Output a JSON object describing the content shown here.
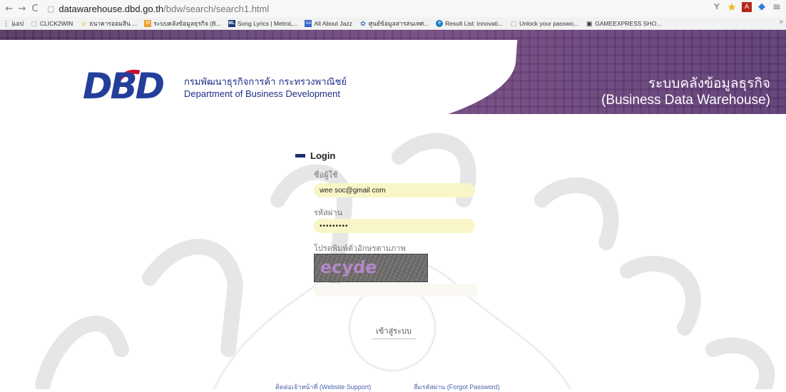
{
  "browser": {
    "url_host": "datawarehouse.dbd.go.th",
    "url_path": "/bdw/search/search1.html",
    "bookmarks": [
      {
        "label": "แอป",
        "icon": "apps-icon"
      },
      {
        "label": "CLICK2WIN",
        "icon": "page-icon"
      },
      {
        "label": "ธนาคารออมสิน ...",
        "icon": "smiley-icon"
      },
      {
        "label": "ระบบคลังข้อมูลธุรกิจ (B...",
        "icon": "mail-icon"
      },
      {
        "label": "Song Lyrics | MetroL...",
        "icon": "metrolyrics-icon"
      },
      {
        "label": "All About Jazz",
        "icon": "jazz-icon"
      },
      {
        "label": "ศูนย์ข้อมูลสารสนเทศ...",
        "icon": "flower-icon"
      },
      {
        "label": "Result List: innovati...",
        "icon": "globe-icon"
      },
      {
        "label": "Unlock your passwo...",
        "icon": "page-icon"
      },
      {
        "label": "GAMEEXPRESS SHO...",
        "icon": "gamepad-icon"
      }
    ],
    "more_label": "»"
  },
  "banner": {
    "logo_text": "DBD",
    "org_name_th": "กรมพัฒนาธุรกิจการค้า กระทรวงพาณิชย์",
    "org_name_en": "Department of Business Development",
    "system_name_th": "ระบบคลังข้อมูลธุรกิจ",
    "system_name_en": "(Business Data Warehouse)",
    "colors": {
      "banner": "#5b3a6e",
      "logo_blue": "#233f9a",
      "logo_red": "#c8102e"
    }
  },
  "login": {
    "title": "Login",
    "username_label": "ชื่อผู้ใช้",
    "username_value": "wee soc@gmail com",
    "password_label": "รหัสผ่าน",
    "password_value": "•••••••••",
    "captcha_label": "โปรดพิมพ์ตัวอักษรตามภาพ",
    "captcha_text": "ecyde",
    "submit_label": "เข้าสู่ระบบ"
  },
  "footer": {
    "link1": "ติดต่อเจ้าหน้าที่ (Website Support)",
    "link2": "ลืมรหัสผ่าน (Forgot Password)"
  }
}
